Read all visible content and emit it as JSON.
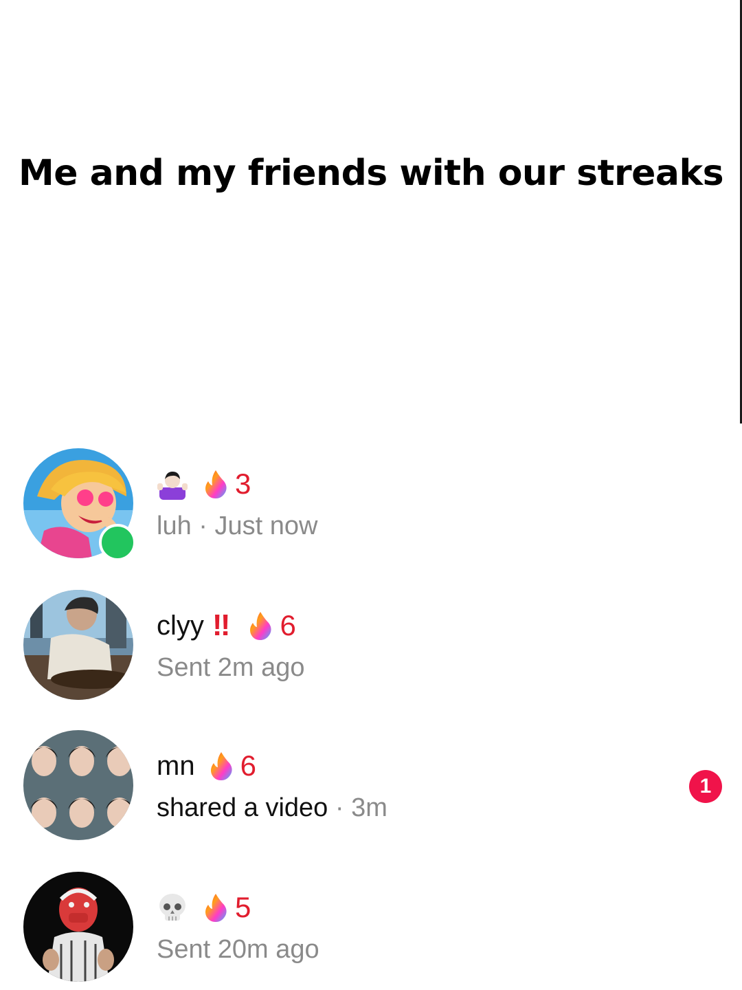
{
  "meme_caption": "Me and my friends with our streaks",
  "chats": [
    {
      "name_emoji": "person-shrugging-emoji",
      "streak_icon": "flame-icon",
      "streak_count": "3",
      "status_prefix": "luh",
      "separator": " · ",
      "status_time": "Just now",
      "online": true
    },
    {
      "name": "clyy",
      "name_suffix": "‼",
      "streak_icon": "flame-icon",
      "streak_count": "6",
      "status": "Sent 2m ago"
    },
    {
      "name": "mn",
      "streak_icon": "flame-icon",
      "streak_count": "6",
      "status_activity": "shared a video",
      "separator": " · ",
      "status_time": "3m",
      "unread_count": "1"
    },
    {
      "name_emoji": "skull-emoji",
      "streak_icon": "flame-icon",
      "streak_count": "5",
      "status": "Sent 20m ago"
    }
  ],
  "colors": {
    "streak_count": "#e11d2e",
    "online_dot": "#22c55e",
    "unread_badge": "#f0134a",
    "secondary_text": "#8a8a8a"
  }
}
